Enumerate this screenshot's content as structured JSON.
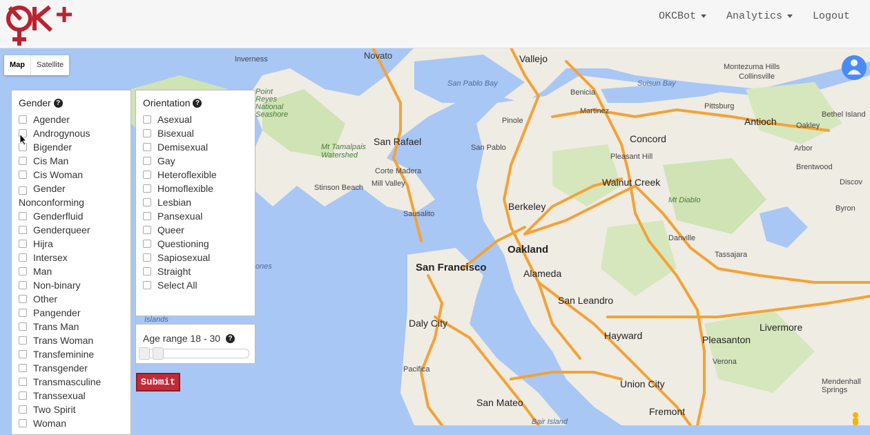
{
  "navbar": {
    "links": [
      {
        "label": "OKCBot",
        "dropdown": true
      },
      {
        "label": "Analytics",
        "dropdown": true
      },
      {
        "label": "Logout",
        "dropdown": false
      }
    ]
  },
  "map_type": {
    "map": "Map",
    "satellite": "Satellite",
    "selected": "Map"
  },
  "map_labels": {
    "novato": "Novato",
    "vallejo": "Vallejo",
    "inverness": "Inverness",
    "benicia": "Benicia",
    "san_pablo_bay": "San Pablo Bay",
    "suisun_bay": "Suisun Bay",
    "montezuma": "Montezuma Hills",
    "collinsville": "Collinsville",
    "bethel": "Bethel Island",
    "pittsburg": "Pittsburg",
    "martinez": "Martinez",
    "antioch": "Antioch",
    "oakley": "Oakley",
    "pinole": "Pinole",
    "san_rafael": "San Rafael",
    "san_pablo": "San Pablo",
    "concord": "Concord",
    "arbor": "Arbor",
    "brentwood": "Brentwood",
    "discovery": "Discov",
    "mt_tam": "Mt Tamalpais Watershed",
    "corte_madera": "Corte Madera",
    "pleasant_hill": "Pleasant Hill",
    "walnut_creek": "Walnut Creek",
    "stinson": "Stinson Beach",
    "mill_valley": "Mill Valley",
    "mt_diablo": "Mt Diablo",
    "berkeley": "Berkeley",
    "byron": "Byron",
    "sausalito": "Sausalito",
    "danville": "Danville",
    "oakland": "Oakland",
    "san_francisco": "San Francisco",
    "alameda": "Alameda",
    "tassajara": "Tassajara",
    "point_reyes": "Point Reyes National Seashore",
    "san_leandro": "San Leandro",
    "daly_city": "Daly City",
    "livermore": "Livermore",
    "hayward": "Hayward",
    "pleasanton": "Pleasanton",
    "islands": "Islands",
    "ones": "ones",
    "verona": "Verona",
    "pacifica": "Pacifica",
    "union_city": "Union City",
    "mendenhall": "Mendenhall Springs",
    "san_mateo": "San Mateo",
    "fremont": "Fremont",
    "bair_island": "Bair Island"
  },
  "gender_panel": {
    "title": "Gender",
    "options": [
      "Agender",
      "Androgynous",
      "Bigender",
      "Cis Man",
      "Cis Woman",
      "Gender Nonconforming",
      "Genderfluid",
      "Genderqueer",
      "Hijra",
      "Intersex",
      "Man",
      "Non-binary",
      "Other",
      "Pangender",
      "Trans Man",
      "Trans Woman",
      "Transfeminine",
      "Transgender",
      "Transmasculine",
      "Transsexual",
      "Two Spirit",
      "Woman"
    ]
  },
  "orientation_panel": {
    "title": "Orientation",
    "options": [
      "Asexual",
      "Bisexual",
      "Demisexual",
      "Gay",
      "Heteroflexible",
      "Homoflexible",
      "Lesbian",
      "Pansexual",
      "Queer",
      "Questioning",
      "Sapiosexual",
      "Straight",
      "Select All"
    ]
  },
  "age_range": {
    "label": "Age range 18 - 30",
    "min": 18,
    "max": 30
  },
  "submit": {
    "label": "Submit"
  },
  "colors": {
    "brand": "#c32a37",
    "water": "#a9c7f5",
    "land": "#efece4",
    "road": "#f4a235"
  }
}
